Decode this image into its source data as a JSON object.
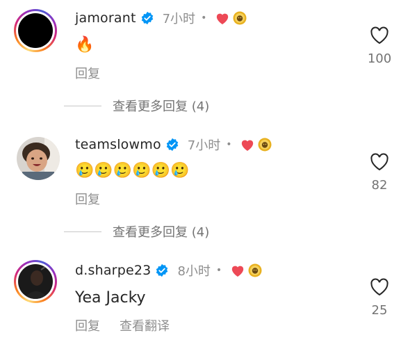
{
  "comments": [
    {
      "username": "jamorant",
      "time": "7小时",
      "dot": "•",
      "text": "🔥",
      "reply_label": "回复",
      "likes": "100",
      "view_more": "查看更多回复 (4)"
    },
    {
      "username": "teamslowmo",
      "time": "7小时",
      "dot": "•",
      "text": "🥲🥲🥲🥲🥲🥲",
      "reply_label": "回复",
      "likes": "82",
      "view_more": "查看更多回复 (4)"
    },
    {
      "username": "d.sharpe23",
      "time": "8小时",
      "dot": "•",
      "text": "Yea Jacky",
      "reply_label": "回复",
      "translate_label": "查看翻译",
      "likes": "25"
    }
  ],
  "colors": {
    "verified": "#0095f6",
    "heart": "#ed4956",
    "lion_badge": "#e8b120",
    "secondary_text": "#8e8e8e"
  },
  "icons": [
    "verified-badge-icon",
    "heart-badge-icon",
    "lion-badge-icon",
    "like-heart-outline-icon"
  ]
}
